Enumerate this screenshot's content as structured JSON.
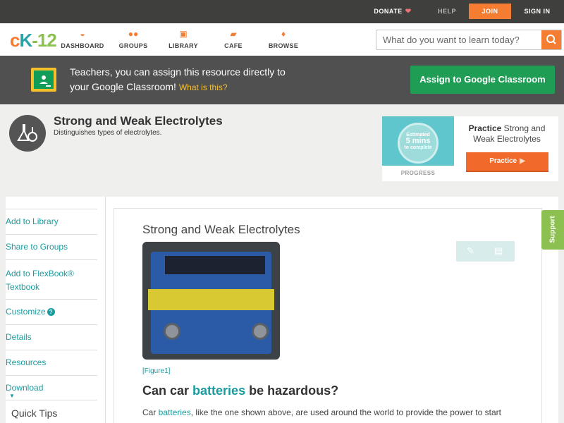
{
  "topbar": {
    "donate": "DONATE",
    "help": "HELP",
    "join": "JOIN",
    "signin": "SIGN IN"
  },
  "nav": {
    "logo": {
      "c": "c",
      "k": "K",
      "n": "-12"
    },
    "items": [
      {
        "label": "DASHBOARD",
        "icon": "dashboard-icon"
      },
      {
        "label": "GROUPS",
        "icon": "groups-icon"
      },
      {
        "label": "LIBRARY",
        "icon": "library-icon"
      },
      {
        "label": "CAFE",
        "icon": "cafe-icon"
      },
      {
        "label": "BROWSE",
        "icon": "browse-icon"
      }
    ],
    "search_placeholder": "What do you want to learn today?"
  },
  "classroom_banner": {
    "text_line1": "Teachers, you can assign this resource directly to",
    "text_line2": "your Google Classroom!",
    "what_link": "What is this?",
    "button": "Assign to Google Classroom"
  },
  "concept": {
    "title": "Strong and Weak Electrolytes",
    "subtitle": "Distinguishes types of electrolytes."
  },
  "practice": {
    "estimated": "Estimated",
    "mins": "5 mins",
    "complete": "to complete",
    "progress": "PROGRESS",
    "title_bold": "Practice",
    "title_rest": "Strong and Weak Electrolytes",
    "button": "Practice"
  },
  "sidebar": {
    "items": [
      "Add to Library",
      "Share to Groups",
      "Add to FlexBook®",
      "Textbook",
      "Customize",
      "Details",
      "Resources",
      "Download"
    ],
    "quick_tips": "Quick Tips"
  },
  "article": {
    "title": "Strong and Weak Electrolytes",
    "figure_caption": "[Figure1]",
    "heading_pre": "Can car ",
    "heading_kw": "batteries",
    "heading_post": " be hazardous?",
    "para_pre": "Car ",
    "para_kw": "batteries",
    "para_post": ", like the one shown above, are used around the world to provide the power to start"
  },
  "support": "Support",
  "colors": {
    "accent_orange": "#f47d31",
    "teal": "#1a9c9f",
    "google_green": "#1f9d55",
    "support_green": "#8cc152"
  }
}
